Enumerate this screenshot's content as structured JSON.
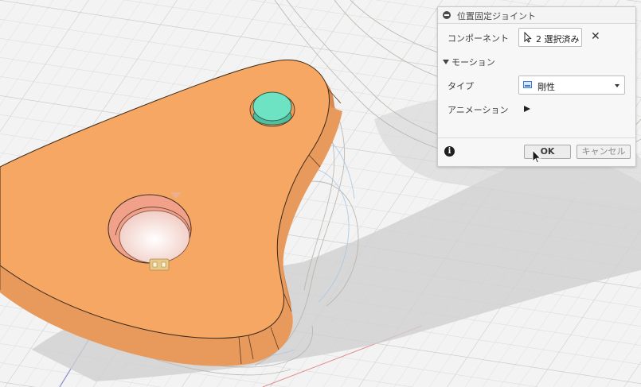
{
  "dialog": {
    "title": "位置固定ジョイント",
    "component_label": "コンポーネント",
    "selection_text": "2 選択済み",
    "section_label": "モーション",
    "type_label": "タイプ",
    "type_value": "剛性",
    "animation_label": "アニメーション",
    "ok_label": "OK",
    "cancel_label": "キャンセル"
  },
  "colors": {
    "part": "#f6a763",
    "part_shadow": "#e0935a",
    "hole_inner": "#f1a08a",
    "pin": "#6ee3c3",
    "accent": "#3a7bd5"
  },
  "icons": {
    "collapse": "collapse-icon",
    "cursor": "cursor-icon",
    "clear": "close-icon",
    "rigid": "rigid-joint-icon",
    "play": "play-icon",
    "info": "info-icon",
    "joint_glyph": "joint-glyph-icon"
  }
}
